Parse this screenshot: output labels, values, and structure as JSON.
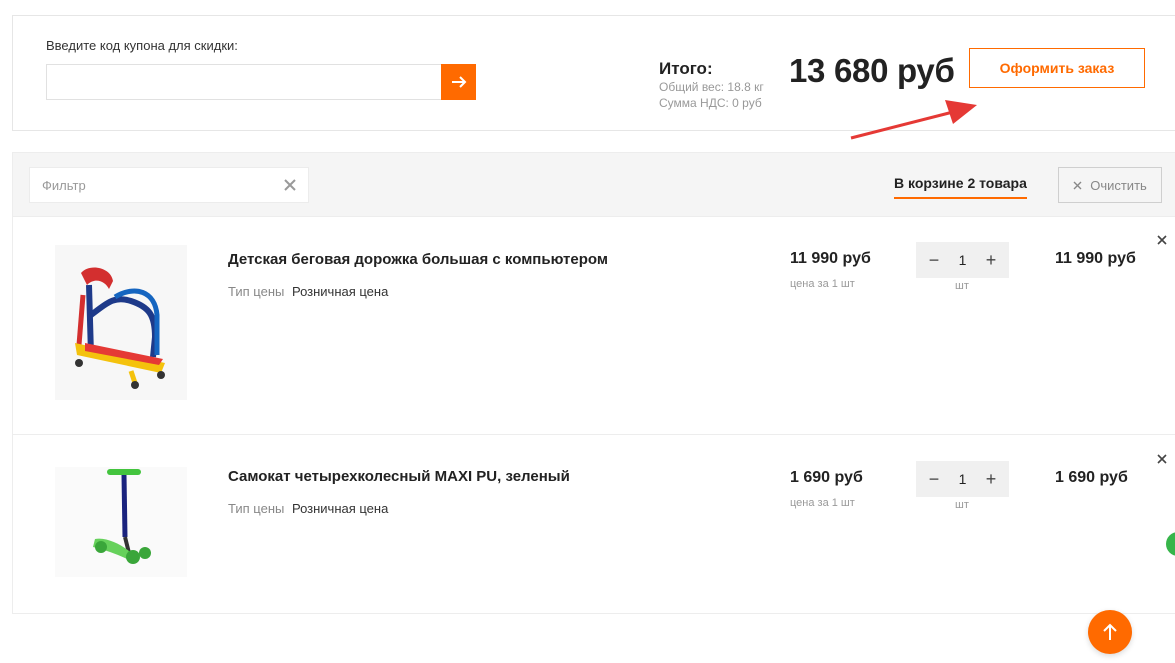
{
  "coupon": {
    "label": "Введите код купона для скидки:",
    "placeholder": ""
  },
  "totals": {
    "label": "Итого:",
    "weight": "Общий вес: 18.8 кг",
    "vat": "Сумма НДС: 0 руб",
    "price": "13 680 руб",
    "checkout_label": "Оформить заказ"
  },
  "filter": {
    "placeholder": "Фильтр",
    "basket_count": "В корзине 2 товара",
    "clear_label": "Очистить"
  },
  "items": [
    {
      "title": "Детская беговая дорожка большая с компьютером",
      "price_type_label": "Тип цены",
      "price_type_value": "Розничная цена",
      "unit_price": "11 990 руб",
      "unit_note": "цена за 1 шт",
      "qty": "1",
      "qty_unit": "шт",
      "total": "11 990 руб"
    },
    {
      "title": "Самокат четырехколесный MAXI PU, зеленый",
      "price_type_label": "Тип цены",
      "price_type_value": "Розничная цена",
      "unit_price": "1 690 руб",
      "unit_note": "цена за 1 шт",
      "qty": "1",
      "qty_unit": "шт",
      "total": "1 690 руб"
    }
  ],
  "icons": {
    "coupon_submit": "arrow-right-icon",
    "filter_clear": "close-icon",
    "remove_item": "close-icon",
    "scroll_top": "arrow-up-icon"
  },
  "colors": {
    "accent": "#ff6a00",
    "annotation": "#e53935"
  }
}
